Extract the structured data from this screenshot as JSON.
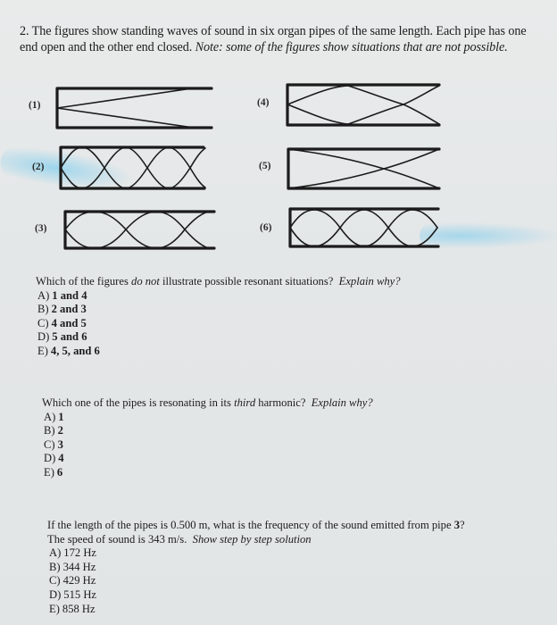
{
  "problem": {
    "number": "2.",
    "intro_plain": "The figures show standing waves of sound in six organ pipes of the same length.  Each pipe has one end open and the other end closed.",
    "intro_note": "Note: some of the figures show situations that are not possible."
  },
  "pipes": [
    {
      "label": "(1)",
      "description": "closed left, open right; fundamental (quarter wavelength)"
    },
    {
      "label": "(2)",
      "description": "closed left, open right; multiple loops with nodes"
    },
    {
      "label": "(3)",
      "description": "closed left, open right; loops"
    },
    {
      "label": "(4)",
      "description": "closed left, open right; three-quarter wavelength pattern"
    },
    {
      "label": "(5)",
      "description": "closed both ends, node crossing in middle"
    },
    {
      "label": "(6)",
      "description": "closed left, open right; three loops"
    }
  ],
  "question1": {
    "stem_a": "Which of the figures ",
    "stem_em": "do not",
    "stem_b": " illustrate possible resonant situations?",
    "stem_explain": "Explain why?",
    "options": [
      {
        "letter": "A)",
        "value": "1 and 4"
      },
      {
        "letter": "B)",
        "value": "2 and 3"
      },
      {
        "letter": "C)",
        "value": "4 and 5"
      },
      {
        "letter": "D)",
        "value": "5 and 6"
      },
      {
        "letter": "E)",
        "value": "4, 5, and 6"
      }
    ]
  },
  "question2": {
    "stem_a": "Which one of the pipes is resonating in its ",
    "stem_em": "third",
    "stem_b": " harmonic?",
    "stem_explain": "Explain why?",
    "options": [
      {
        "letter": "A)",
        "value": "1"
      },
      {
        "letter": "B)",
        "value": "2"
      },
      {
        "letter": "C)",
        "value": "3"
      },
      {
        "letter": "D)",
        "value": "4"
      },
      {
        "letter": "E)",
        "value": "6"
      }
    ]
  },
  "question3": {
    "stem_line1_a": "If the length of the pipes is 0.500 m, what is the frequency of the sound emitted from pipe ",
    "stem_line1_bold": "3",
    "stem_line1_b": "?",
    "stem_line2": "The speed of sound is 343 m/s.",
    "stem_line2_em": "Show step by step solution",
    "options": [
      {
        "letter": "A)",
        "value": "172 Hz"
      },
      {
        "letter": "B)",
        "value": "344 Hz"
      },
      {
        "letter": "C)",
        "value": "429 Hz"
      },
      {
        "letter": "D)",
        "value": "515 Hz"
      },
      {
        "letter": "E)",
        "value": "858 Hz"
      }
    ]
  }
}
